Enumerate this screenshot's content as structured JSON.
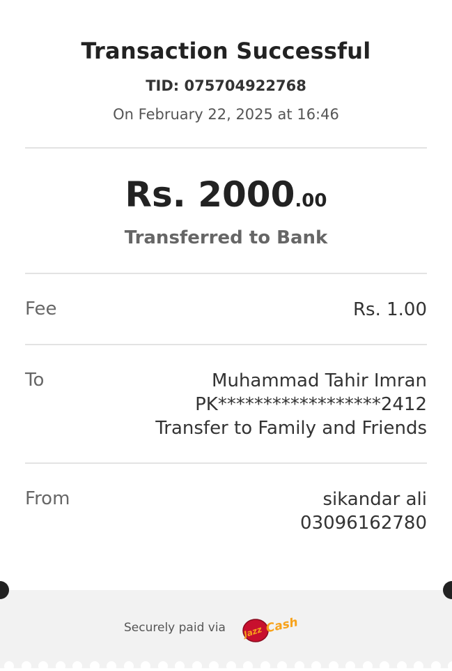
{
  "receipt": {
    "title": "Transaction Successful",
    "tid": "TID: 075704922768",
    "date": "On February 22, 2025 at 16:46",
    "amount_main": "Rs. 2000",
    "amount_cents": ".00",
    "status": "Transferred to Bank",
    "fee": {
      "label": "Fee",
      "value": "Rs. 1.00"
    },
    "to": {
      "label": "To",
      "name": "Muhammad Tahir Imran",
      "account": "PK******************2412",
      "purpose": "Transfer to Family and Friends"
    },
    "from": {
      "label": "From",
      "name": "sikandar ali",
      "number": "03096162780"
    }
  },
  "footer": {
    "secure_text": "Securely paid via",
    "logo_icon": "jazzcash-logo",
    "logo_text": "JazzCash"
  },
  "colors": {
    "text_dark": "#222222",
    "text_muted": "#666666",
    "divider": "#e3e3e3",
    "footer_bg": "#f2f2f2",
    "logo_red": "#c8102e",
    "logo_orange": "#f7a21b"
  }
}
